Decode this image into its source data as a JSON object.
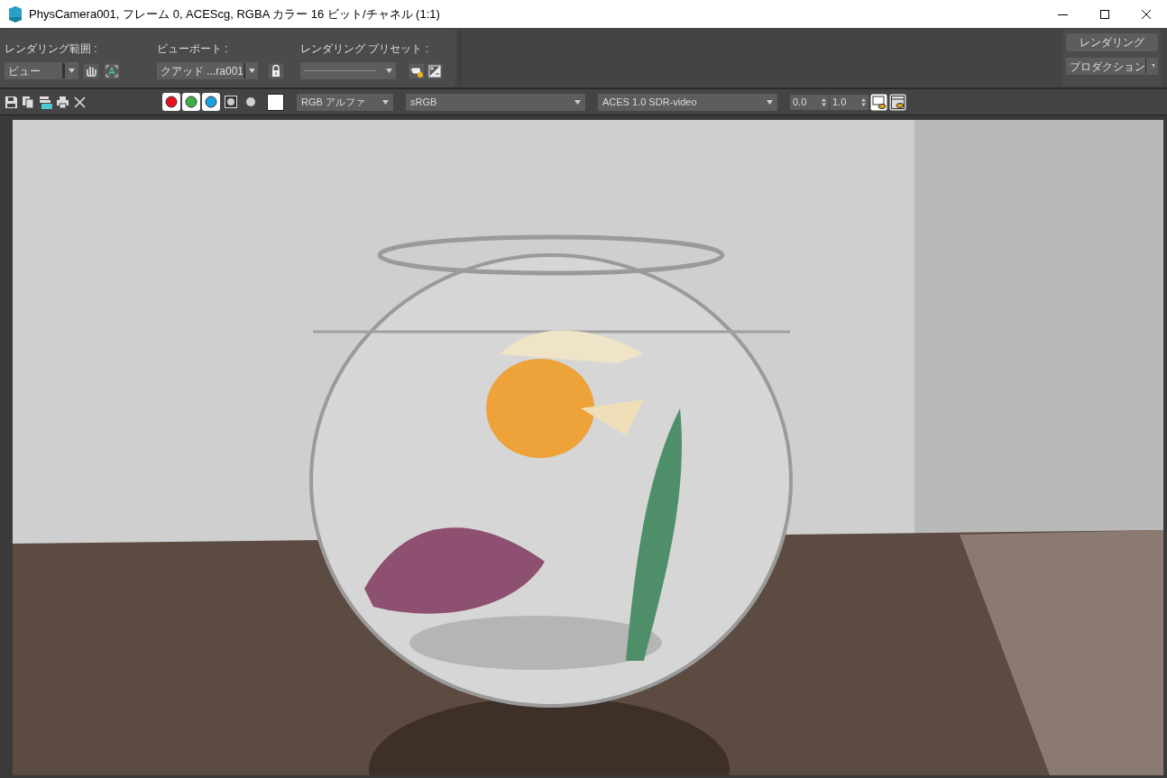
{
  "window": {
    "title": "PhysCamera001, フレーム 0, ACEScg, RGBA カラー 16 ビット/チャネル (1:1)"
  },
  "render_area": {
    "label": "レンダリング範囲 :",
    "value": "ビュー"
  },
  "viewport": {
    "label": "ビューポート :",
    "value": "クアッド ...ra001"
  },
  "preset": {
    "label": "レンダリング プリセット :"
  },
  "render_button": "レンダリング",
  "render_mode": {
    "value": "プロダクション"
  },
  "channels": [
    {
      "kind": "red",
      "color": "#e81123",
      "selected": true
    },
    {
      "kind": "green",
      "color": "#3cb043",
      "selected": true
    },
    {
      "kind": "blue",
      "color": "#1ba1e2",
      "selected": true
    },
    {
      "kind": "alpha",
      "selected": false
    },
    {
      "kind": "mono",
      "selected": false
    }
  ],
  "channel_display": {
    "value": "RGB アルファ"
  },
  "color_space": {
    "value": "sRGB"
  },
  "view_transform": {
    "value": "ACES 1.0 SDR-video"
  },
  "spinners": [
    "0.0",
    "1.0"
  ]
}
